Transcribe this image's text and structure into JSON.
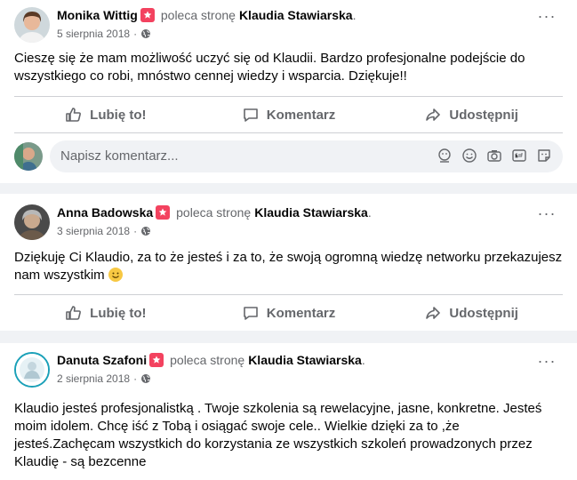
{
  "posts": [
    {
      "author": "Monika Wittig",
      "verb": "poleca stronę",
      "page": "Klaudia Stawiarska",
      "dot": ".",
      "date": "5 sierpnia 2018",
      "sep": "·",
      "text": "Cieszę się że mam możliwość uczyć się od Klaudii. Bardzo profesjonalne podejście do wszystkiego co robi, mnóstwo cennej wiedzy i wsparcia. Dziękuje!!",
      "more": "···"
    },
    {
      "author": "Anna Badowska",
      "verb": "poleca stronę",
      "page": "Klaudia Stawiarska",
      "dot": ".",
      "date": "3 sierpnia 2018",
      "sep": "·",
      "text": "Dziękuję Ci Klaudio, za to że jesteś i za to,  że swoją ogromną wiedzę networku przekazujesz nam wszystkim",
      "more": "···"
    },
    {
      "author": "Danuta Szafoni",
      "verb": "poleca stronę",
      "page": "Klaudia Stawiarska",
      "dot": ".",
      "date": "2 sierpnia 2018",
      "sep": "·",
      "text": "Klaudio jesteś profesjonalistką . Twoje szkolenia są rewelacyjne, jasne, konkretne. Jesteś moim idolem. Chcę iść z Tobą i osiągać swoje cele.. Wielkie dzięki za to ,że jesteś.Zachęcam wszystkich do korzystania ze wszystkich szkoleń prowadzonych przez Klaudię - są bezcenne",
      "more": "···"
    }
  ],
  "actions": {
    "like": "Lubię to!",
    "comment": "Komentarz",
    "share": "Udostępnij"
  },
  "comment_box": {
    "placeholder": "Napisz komentarz..."
  },
  "colors": {
    "recommend_badge": "#f3425f",
    "secondary_text": "#65676b",
    "background": "#f0f2f5"
  }
}
